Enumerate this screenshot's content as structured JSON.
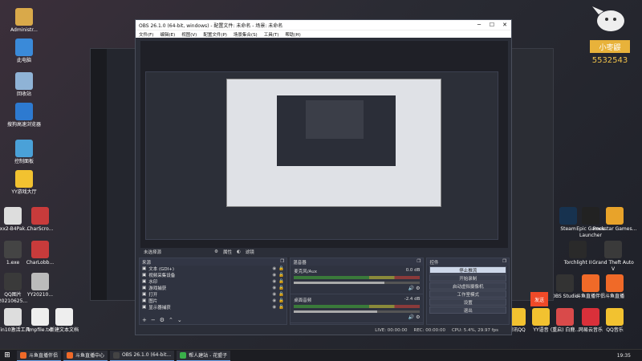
{
  "desktop_icons": [
    {
      "label": "Administr...",
      "color": "#d9a94a"
    },
    {
      "label": "此电脑",
      "color": "#3a8ad9"
    },
    {
      "label": "回收站",
      "color": "#8fb3d6"
    },
    {
      "label": "搜狗高速浏览器",
      "color": "#2d7ad0"
    },
    {
      "label": "控制面板",
      "color": "#4aa1d8"
    },
    {
      "label": "YY游戏大厅",
      "color": "#f2c230"
    },
    {
      "label": "Gxx2-B4Pak...",
      "color": "#dddddd"
    },
    {
      "label": "CharScro...",
      "color": "#c83b3b"
    },
    {
      "label": "1.exe",
      "color": "#444444"
    },
    {
      "label": "CharLobb...",
      "color": "#c83b3b"
    },
    {
      "label": "QQ图片20210625...",
      "color": "#3a3a3a"
    },
    {
      "label": "YY20210...",
      "color": "#bbbbbb"
    },
    {
      "label": "Win10激活工具",
      "color": "#dddddd"
    },
    {
      "label": "tmpfile.txt",
      "color": "#eeeeee"
    },
    {
      "label": "新建文本文档",
      "color": "#eeeeee"
    }
  ],
  "right_icons": [
    {
      "label": "Steam",
      "color": "#17324f"
    },
    {
      "label": "Epic Games Launcher",
      "color": "#222222"
    },
    {
      "label": "Rockstar Games...",
      "color": "#e8a32a"
    },
    {
      "label": "Torchlight II",
      "color": "#2a2a2a"
    },
    {
      "label": "Grand Theft Auto V",
      "color": "#3a3a3a"
    },
    {
      "label": "OBS Studio",
      "color": "#333333"
    },
    {
      "label": "斗鱼直播伴侣",
      "color": "#f06a28"
    },
    {
      "label": "斗鱼直播",
      "color": "#f06a28"
    },
    {
      "label": "腾讯QQ",
      "color": "#f2c230"
    },
    {
      "label": "YY语音",
      "color": "#f2c230"
    },
    {
      "label": "(重启) 白鹿...",
      "color": "#d94a4a"
    },
    {
      "label": "网易云音乐",
      "color": "#d9303a"
    },
    {
      "label": "QQ音乐",
      "color": "#f2c230"
    }
  ],
  "streamer": {
    "name": "小枣鼹",
    "fans": "5532543"
  },
  "obs": {
    "title": "OBS 26.1.0 (64-bit, windows) - 配置文件: 未命名 - 场景: 未命名",
    "menu": [
      "文件(F)",
      "编辑(E)",
      "视图(V)",
      "配置文件(P)",
      "场景集合(S)",
      "工具(T)",
      "帮助(H)"
    ],
    "controls": [
      "─",
      "☐",
      "✕"
    ],
    "scene_bar": {
      "label": "未选择源",
      "properties": "属性",
      "filters": "滤镜"
    },
    "sources_title": "来源",
    "sources": [
      "文本 (GDI+)",
      "视频采集设备",
      "水印",
      "游戏捕获",
      "打开",
      "图片",
      "显示器捕获"
    ],
    "mixer_title": "混音器",
    "mixer": [
      {
        "name": "麦克风/Aux",
        "db": "0.0 dB",
        "level": 0.72
      },
      {
        "name": "桌面音频",
        "db": "-2.4 dB",
        "level": 0.66
      }
    ],
    "controls_title": "控件",
    "buttons": [
      "停止推流",
      "开始录制",
      "启动虚拟摄像机",
      "工作室模式",
      "设置",
      "退出"
    ],
    "active_button": "停止推流",
    "status": {
      "live": "LIVE: 00:00:00",
      "rec": "REC: 00:00:00",
      "cpu": "CPU: 5.4%, 29.97 fps"
    }
  },
  "chat_send": "发送",
  "taskbar": {
    "items": [
      {
        "label": "斗鱼直播伴侣",
        "color": "#f06a28"
      },
      {
        "label": "斗鱼直播中心",
        "color": "#f06a28"
      },
      {
        "label": "OBS 26.1.0 (64-bit...",
        "color": "#444444"
      },
      {
        "label": "帮人建站 - 花盟子",
        "color": "#3ab04a"
      }
    ],
    "time": "19:35"
  }
}
